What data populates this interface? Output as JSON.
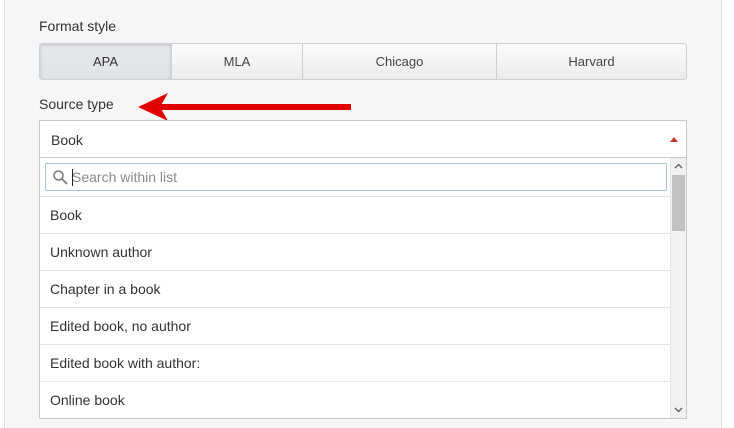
{
  "format": {
    "label": "Format style",
    "options": [
      "APA",
      "MLA",
      "Chicago",
      "Harvard"
    ],
    "selected": "APA"
  },
  "source": {
    "label": "Source type",
    "value": "Book",
    "search_placeholder": "Search within list",
    "options": [
      "Book",
      "Unknown author",
      "Chapter in a book",
      "Edited book, no author",
      "Edited book with author:",
      "Online book"
    ]
  },
  "colors": {
    "arrow": "#e10000",
    "caret": "#c0392b",
    "search_border": "#a9c4d8"
  },
  "icons": {
    "search": "search-icon",
    "arrow": "left-arrow-icon",
    "caret": "caret-up-icon"
  }
}
